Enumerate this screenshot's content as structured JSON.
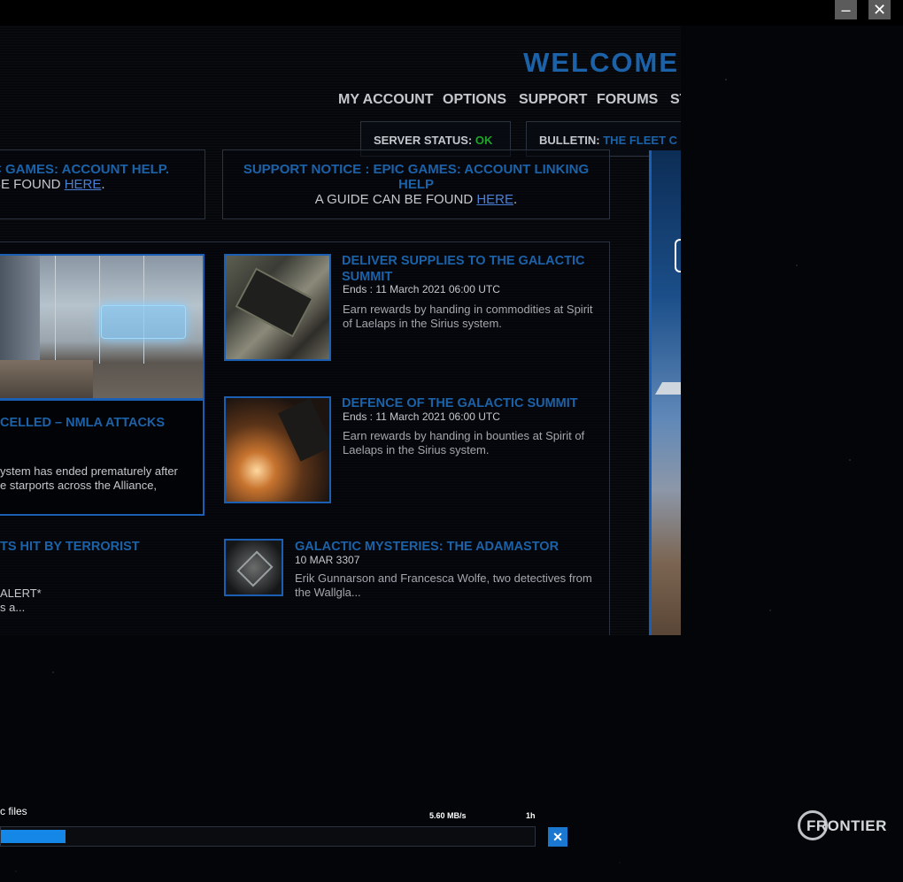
{
  "window": {
    "minimize_glyph": "–",
    "close_glyph": "✕"
  },
  "header": {
    "welcome": "WELCOME",
    "nav": [
      "MY ACCOUNT",
      "OPTIONS",
      "SUPPORT",
      "FORUMS",
      "ST"
    ]
  },
  "status": {
    "server_label": "SERVER STATUS:",
    "server_value": "OK",
    "bulletin_label": "BULLETIN:",
    "bulletin_value": "THE FLEET C"
  },
  "notices": [
    {
      "title": "C GAMES: ACCOUNT HELP.",
      "body_prefix": "BE FOUND",
      "link": "HERE",
      "body_suffix": "."
    },
    {
      "title": "SUPPORT NOTICE : EPIC GAMES: ACCOUNT LINKING HELP",
      "body_prefix": "A GUIDE CAN BE FOUND",
      "link": "HERE",
      "body_suffix": "."
    }
  ],
  "featured": {
    "title": "CELLED – NMLA ATTACKS",
    "desc": "ystem has ended prematurely after\ne starports across the Alliance,"
  },
  "featured2": {
    "title": "TS HIT BY TERRORIST",
    "desc": "ALERT*\ns a..."
  },
  "items": [
    {
      "title": "DELIVER SUPPLIES TO THE GALACTIC SUMMIT",
      "date": "Ends : 11 March 2021 06:00 UTC",
      "desc": "Earn rewards by handing in commodities at Spirit of Laelaps in the Sirius system."
    },
    {
      "title": "DEFENCE OF THE GALACTIC SUMMIT",
      "date": "Ends : 11 March 2021 06:00 UTC",
      "desc": "Earn rewards by handing in bounties at Spirit of Laelaps in the Sirius system."
    },
    {
      "title": "GALACTIC MYSTERIES: THE ADAMASTOR",
      "date": "10 MAR 3307",
      "desc": "Erik Gunnarson and Francesca Wolfe, two detectives from the Wallgla..."
    }
  ],
  "download": {
    "label": "c files",
    "speed": "5.60 MB/s",
    "time": "1h",
    "progress": 0.12,
    "cancel_glyph": "✕"
  },
  "brand": {
    "logo_text": "FRONTIER"
  },
  "colors": {
    "accent": "#1c62a8",
    "ok": "#1fa62a",
    "progress": "#1587e6"
  }
}
